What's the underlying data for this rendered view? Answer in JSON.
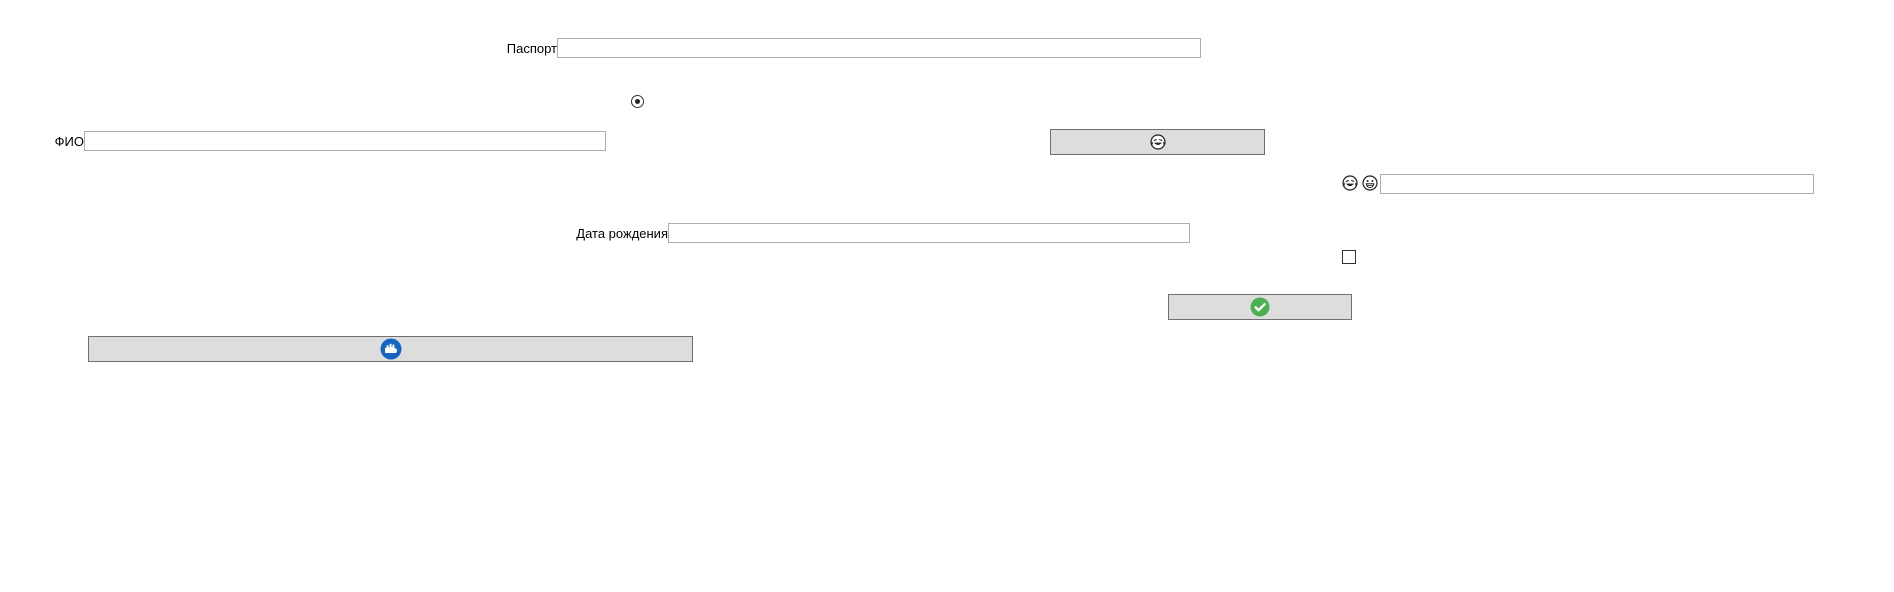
{
  "form": {
    "passport": {
      "label": "Паспорт",
      "value": "",
      "placeholder": ""
    },
    "fio": {
      "label": "ФИО",
      "value": "",
      "placeholder": ""
    },
    "birthdate": {
      "label": "Дата рождения",
      "value": "",
      "placeholder": ""
    },
    "emoji_field": {
      "value": "",
      "placeholder": ""
    },
    "radio": {
      "checked": true
    },
    "checkbox": {
      "checked": false
    }
  },
  "buttons": {
    "emoji_button": {
      "icon": "laughing-face-icon"
    },
    "confirm_button": {
      "icon": "check-circle-icon",
      "color": "#4caf50"
    },
    "blue_button": {
      "icon": "blue-round-logo-icon",
      "color": "#1565c0"
    }
  },
  "emoji_labels": [
    "laughing-face-icon",
    "grinning-face-icon"
  ]
}
